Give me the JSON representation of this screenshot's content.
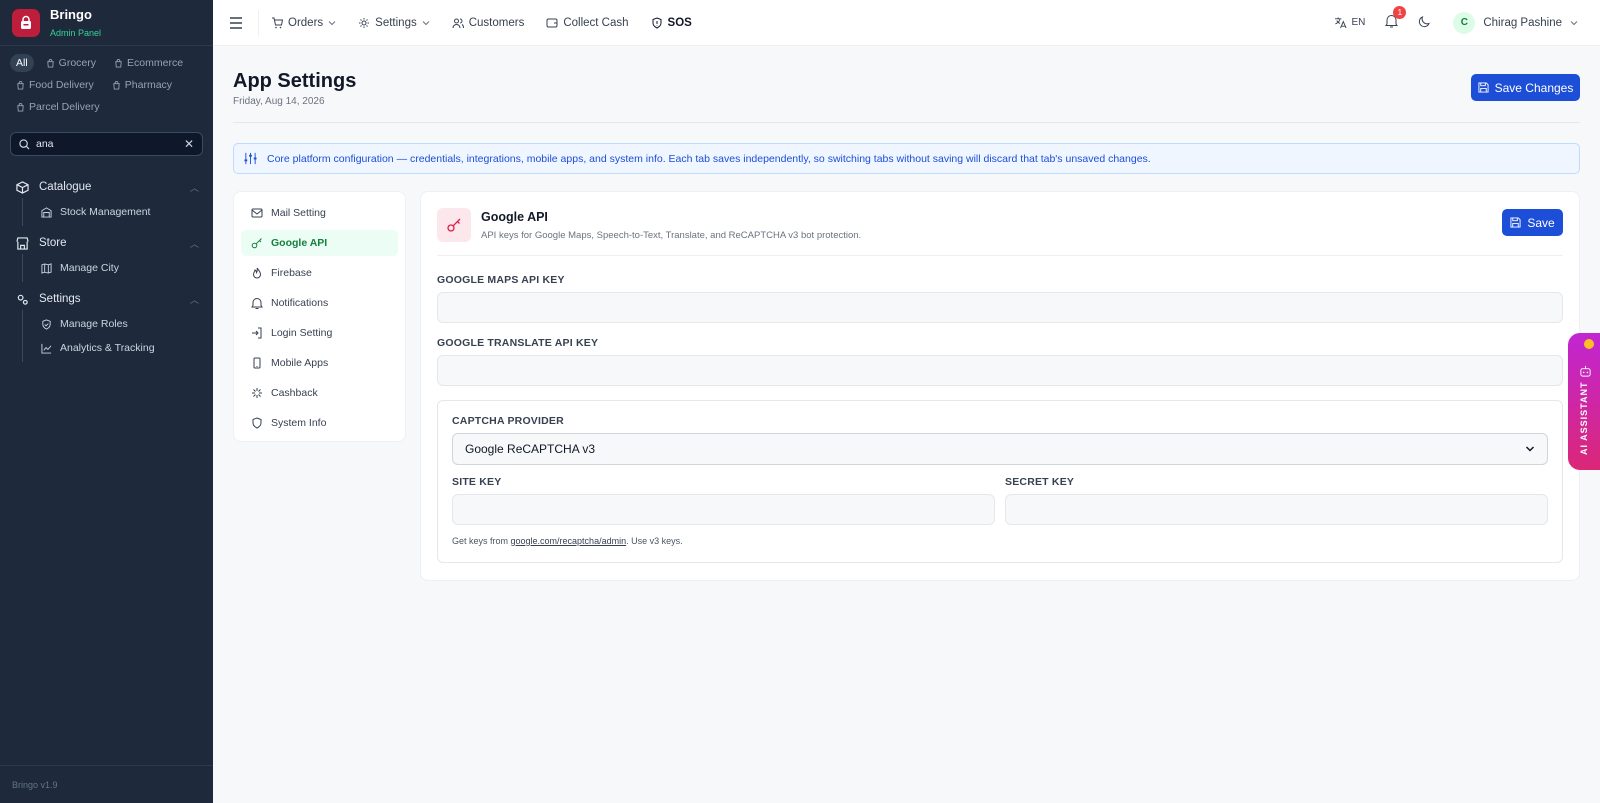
{
  "brand": {
    "name": "Bringo",
    "subtitle": "Admin Panel",
    "version": "Bringo v1.9"
  },
  "filters": [
    {
      "label": "All",
      "active": true
    },
    {
      "label": "Grocery",
      "icon": "bag-icon"
    },
    {
      "label": "Ecommerce",
      "icon": "bag-icon"
    },
    {
      "label": "Food Delivery",
      "icon": "bag-icon"
    },
    {
      "label": "Pharmacy",
      "icon": "bag-icon"
    },
    {
      "label": "Parcel Delivery",
      "icon": "bag-icon"
    }
  ],
  "search": {
    "value": "ana"
  },
  "nav": {
    "catalogue": {
      "label": "Catalogue",
      "items": [
        "Stock Management"
      ]
    },
    "store": {
      "label": "Store",
      "items": [
        "Manage City"
      ]
    },
    "settings": {
      "label": "Settings",
      "items": [
        "Manage Roles",
        "Analytics & Tracking"
      ]
    }
  },
  "topbar": {
    "items": [
      "Orders",
      "Settings",
      "Customers",
      "Collect Cash",
      "SOS"
    ],
    "lang": "EN",
    "notification_count": "1",
    "user": {
      "initial": "C",
      "name": "Chirag Pashine"
    }
  },
  "page": {
    "title": "App Settings",
    "date": "Friday, Aug 14, 2026",
    "save_changes": "Save Changes",
    "info": "Core platform configuration — credentials, integrations, mobile apps, and system info. Each tab saves independently, so switching tabs without saving will discard that tab's unsaved changes."
  },
  "tabs": [
    "Mail Setting",
    "Google API",
    "Firebase",
    "Notifications",
    "Login Setting",
    "Mobile Apps",
    "Cashback",
    "System Info"
  ],
  "active_tab": "Google API",
  "card": {
    "title": "Google API",
    "subtitle": "API keys for Google Maps, Speech-to-Text, Translate, and ReCAPTCHA v3 bot protection.",
    "save": "Save",
    "maps_label": "GOOGLE MAPS API KEY",
    "translate_label": "GOOGLE TRANSLATE API KEY",
    "captcha_label": "CAPTCHA PROVIDER",
    "captcha_value": "Google ReCAPTCHA v3",
    "site_key_label": "SITE KEY",
    "secret_key_label": "SECRET KEY",
    "hint_prefix": "Get keys from ",
    "hint_link": "google.com/recaptcha/admin",
    "hint_suffix": ". Use v3 keys."
  },
  "ai_assistant": "AI ASSISTANT",
  "colors": {
    "primary": "#1d4ed8",
    "sidebar": "#1e293b",
    "accent_green": "#15803d",
    "brand_red": "#be1e3c"
  }
}
